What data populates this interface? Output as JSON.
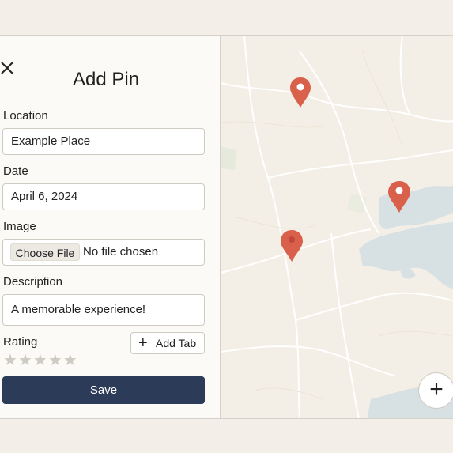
{
  "panel": {
    "title": "Add Pin",
    "location_label": "Location",
    "location_value": "Example Place",
    "date_label": "Date",
    "date_value": "April 6, 2024",
    "image_label": "Image",
    "choose_file_label": "Choose File",
    "file_status": "No file chosen",
    "description_label": "Description",
    "description_value": "A memorable experience!",
    "rating_label": "Rating",
    "rating_value": 0,
    "rating_max": 5,
    "add_tab_label": "Add Tab",
    "save_label": "Save"
  },
  "map": {
    "pins": [
      {
        "name": "map-pin-1",
        "color": "#d9604a"
      },
      {
        "name": "map-pin-2",
        "color": "#d9604a"
      },
      {
        "name": "map-pin-3",
        "color": "#d9604a"
      }
    ],
    "zoom_in_icon": "plus-icon",
    "colors": {
      "land": "#f4efe6",
      "water": "#d7e1e4",
      "roads": "#ffffff",
      "pin": "#d9604a"
    }
  },
  "icons": {
    "close": "close-icon",
    "star": "star-icon",
    "plus": "plus-icon"
  }
}
